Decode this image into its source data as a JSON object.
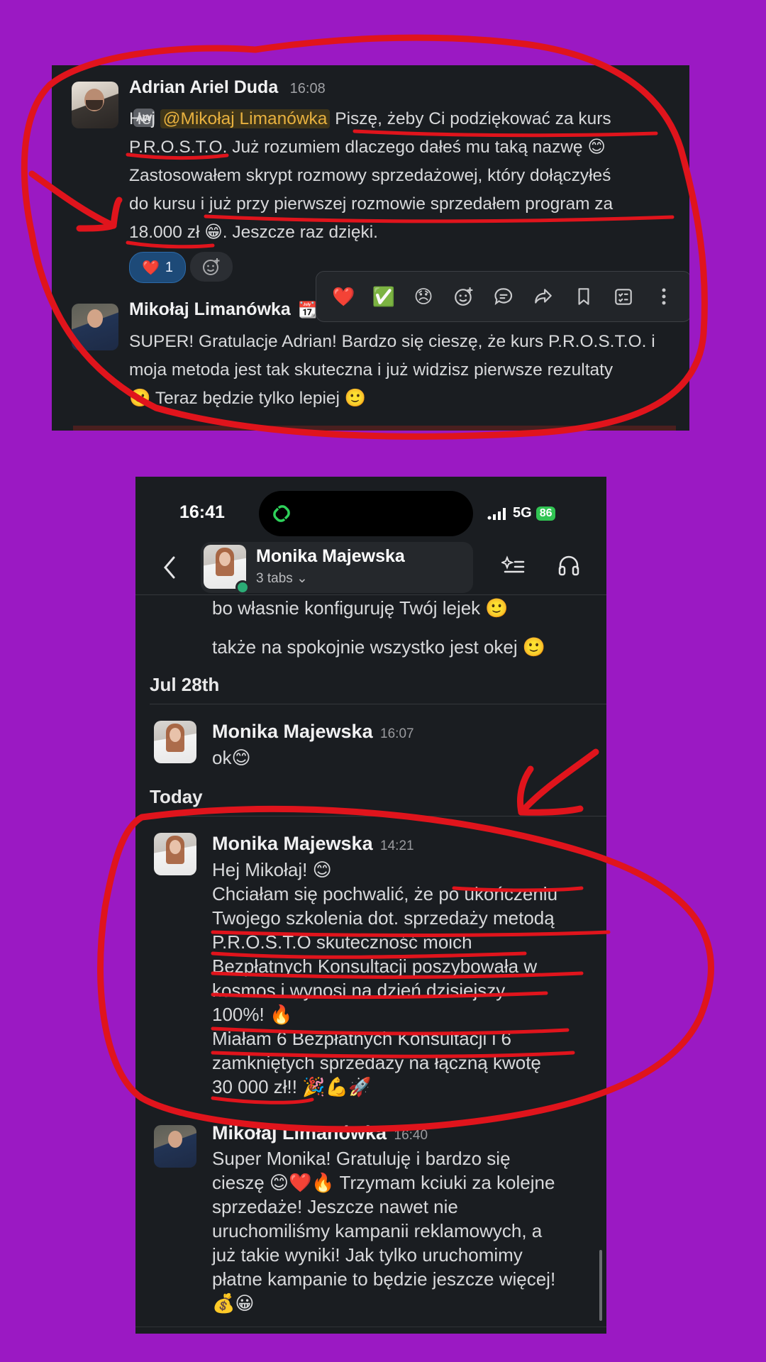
{
  "desktop": {
    "msg1": {
      "author": "Adrian Ariel Duda",
      "time": "16:08",
      "avatar_badge": "AW",
      "l1_pre": "Hej ",
      "mention": "@Mikołaj Limanówka",
      "l1_post": " Piszę, żeby Ci podziękować za kurs",
      "l2": "P.R.O.S.T.O. Już rozumiem dlaczego dałeś mu taką nazwę 😊",
      "l3": "Zastosowałem skrypt rozmowy sprzedażowej, który dołączyłeś",
      "l4": "do kursu i już przy pierwszej rozmowie sprzedałem program za",
      "l5": "18.000 zł 😁. Jeszcze raz dzięki.",
      "reaction_emoji": "❤️",
      "reaction_count": "1"
    },
    "msg2": {
      "author": "Mikołaj Limanówka",
      "status_emoji": "📆",
      "l1": "SUPER! Gratulacje Adrian! Bardzo się cieszę, że kurs P.R.O.S.T.O. i",
      "l2": "moja metoda jest tak skuteczna i już widzisz pierwsze rezultaty",
      "l3": "🙂 Teraz będzie tylko lepiej 🙂"
    },
    "toolbar": {
      "heart": "❤️",
      "check": "✅",
      "disappointed": "😞"
    }
  },
  "phone": {
    "status_time": "16:41",
    "network": "5G",
    "battery": "86",
    "contact_name": "Monika Majewska",
    "contact_sub": "3 tabs ⌄",
    "earlier1": "bo własnie konfiguruję Twój lejek 🙂",
    "earlier2": "także na spokojnie wszystko jest okej 🙂",
    "day1": "Jul 28th",
    "m1": {
      "author": "Monika Majewska",
      "time": "16:07",
      "text": "ok😊"
    },
    "day2": "Today",
    "m2": {
      "author": "Monika Majewska",
      "time": "14:21",
      "lines": [
        "Hej Mikołaj! 😊",
        "Chciałam się pochwalić, że po ukończeniu",
        "Twojego szkolenia dot. sprzedaży metodą",
        "P.R.O.S.T.O skuteczność moich",
        "Bezpłatnych Konsultacji poszybowała w",
        "kosmos i wynosi na dzień dzisiejszy",
        "100%! 🔥",
        "Miałam 6 Bezpłatnych Konsultacji i 6",
        "zamkniętych sprzedaży na łączną kwotę",
        "30 000 zł!! 🎉💪🚀"
      ]
    },
    "m3": {
      "author": "Mikołaj Limanówka",
      "time": "16:40",
      "lines": [
        "Super Monika! Gratuluję i bardzo się",
        "cieszę 😊❤️🔥 Trzymam kciuki za kolejne",
        "sprzedaże! Jeszcze nawet nie",
        "uruchomiliśmy kampanii reklamowych, a",
        "już takie wyniki! Jak tylko uruchomimy",
        "płatne kampanie to będzie jeszcze więcej!",
        "💰😀"
      ]
    }
  },
  "colors": {
    "background": "#9b19c3",
    "panel": "#1a1d21",
    "annotation_red": "#e0141c",
    "mention_text": "#e8b13f",
    "reaction_bg": "#1d4a78"
  }
}
